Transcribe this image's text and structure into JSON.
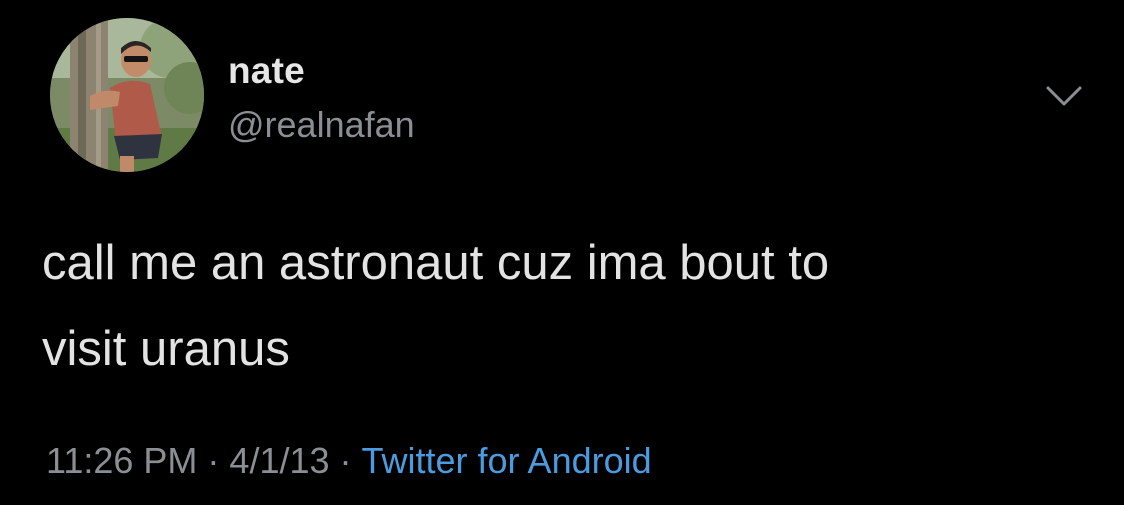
{
  "tweet": {
    "author": {
      "name": "nate",
      "handle": "@realnafan"
    },
    "text_line1": "call me an astronaut cuz ima bout to",
    "text_line2": "visit uranus",
    "meta": {
      "time": "11:26 PM",
      "separator": "·",
      "date": "4/1/13",
      "source": "Twitter for Android"
    },
    "icons": {
      "menu": "chevron-down-icon",
      "avatar": "avatar-photo"
    },
    "colors": {
      "background": "#000000",
      "text": "#e3e3e3",
      "secondary": "#8b8f94",
      "link": "#4b9be0"
    }
  }
}
